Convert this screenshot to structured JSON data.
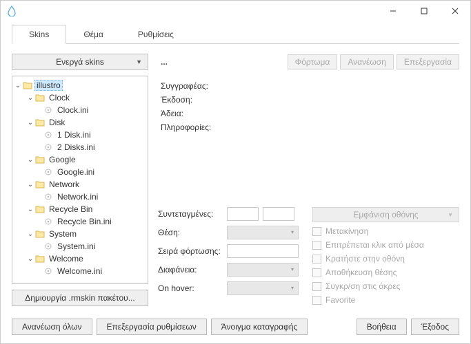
{
  "window": {
    "min": "—",
    "max": "☐",
    "close": "✕"
  },
  "tabs": {
    "skins": "Skins",
    "theme": "Θέμα",
    "settings": "Ρυθμίσεις"
  },
  "activeSkins": "Ενεργά skins",
  "tree": {
    "root": "illustro",
    "clock": "Clock",
    "clockIni": "Clock.ini",
    "disk": "Disk",
    "disk1": "1 Disk.ini",
    "disk2": "2 Disks.ini",
    "google": "Google",
    "googleIni": "Google.ini",
    "network": "Network",
    "networkIni": "Network.ini",
    "recycle": "Recycle Bin",
    "recycleIni": "Recycle Bin.ini",
    "system": "System",
    "systemIni": "System.ini",
    "welcome": "Welcome",
    "welcomeIni": "Welcome.ini"
  },
  "createPkg": "Δημιουργία .rmskin πακέτου...",
  "ellipsis": "...",
  "actions": {
    "load": "Φόρτωμα",
    "refresh": "Ανανέωση",
    "edit": "Επεξεργασία"
  },
  "meta": {
    "author": "Συγγραφέας:",
    "version": "Έκδοση:",
    "license": "Άδεια:",
    "info": "Πληροφορίες:"
  },
  "form": {
    "coords": "Συντεταγμένες:",
    "position": "Θέση:",
    "loadOrder": "Σειρά φόρτωσης:",
    "transparency": "Διαφάνεια:",
    "onHover": "On hover:",
    "displayMonitor": "Εμφάνιση οθόνης"
  },
  "checks": {
    "draggable": "Μετακίνηση",
    "clickThrough": "Επιτρέπεται κλικ από μέσα",
    "keepOnScreen": "Κρατήστε στην οθόνη",
    "savePosition": "Αποθήκευση θέσης",
    "snapEdges": "Συγκρ/ση στις άκρες",
    "favorite": "Favorite"
  },
  "bottom": {
    "refreshAll": "Ανανέωση όλων",
    "editSettings": "Επεξεργασία ρυθμίσεων",
    "openLog": "Άνοιγμα καταγραφής",
    "help": "Βοήθεια",
    "exit": "Έξοδος"
  }
}
